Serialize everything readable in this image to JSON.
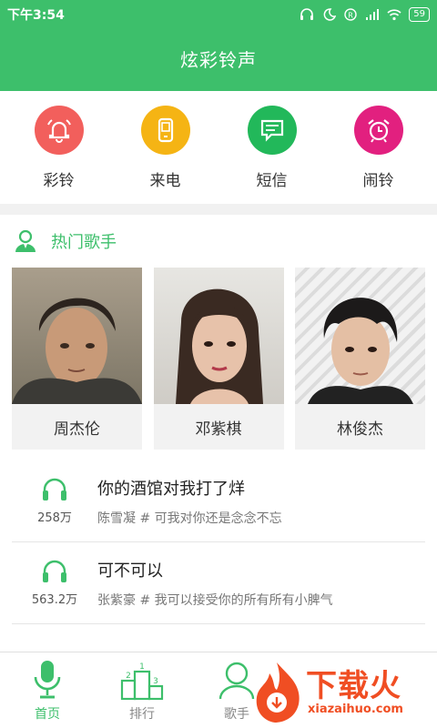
{
  "status_bar": {
    "time": "下午3:54",
    "battery": "59"
  },
  "header": {
    "title": "炫彩铃声"
  },
  "categories": [
    {
      "label": "彩铃",
      "icon": "bell-icon",
      "color": "#f25f5c"
    },
    {
      "label": "来电",
      "icon": "phone-icon",
      "color": "#f5b414"
    },
    {
      "label": "短信",
      "icon": "message-icon",
      "color": "#22b85a"
    },
    {
      "label": "闹铃",
      "icon": "alarm-clock-icon",
      "color": "#e2207f"
    }
  ],
  "hot_singers": {
    "title": "热门歌手",
    "icon": "person-icon",
    "items": [
      {
        "name": "周杰伦"
      },
      {
        "name": "邓紫棋"
      },
      {
        "name": "林俊杰"
      }
    ]
  },
  "songs": [
    {
      "title": "你的酒馆对我打了烊",
      "subtitle": "陈雪凝 # 可我对你还是念念不忘",
      "count": "258万",
      "icon": "headphones-icon"
    },
    {
      "title": "可不可以",
      "subtitle": "张紫豪 # 我可以接受你的所有所有小脾气",
      "count": "563.2万",
      "icon": "headphones-icon"
    }
  ],
  "bottom_nav": [
    {
      "label": "首页",
      "icon": "microphone-icon",
      "active": true
    },
    {
      "label": "排行",
      "icon": "podium-icon",
      "active": false
    },
    {
      "label": "歌手",
      "icon": "user-icon",
      "active": false
    }
  ],
  "watermark": {
    "text": "下载火",
    "url": "xiazaihuo.com"
  },
  "colors": {
    "primary": "#3dbf6b",
    "watermark": "#f04e23"
  }
}
